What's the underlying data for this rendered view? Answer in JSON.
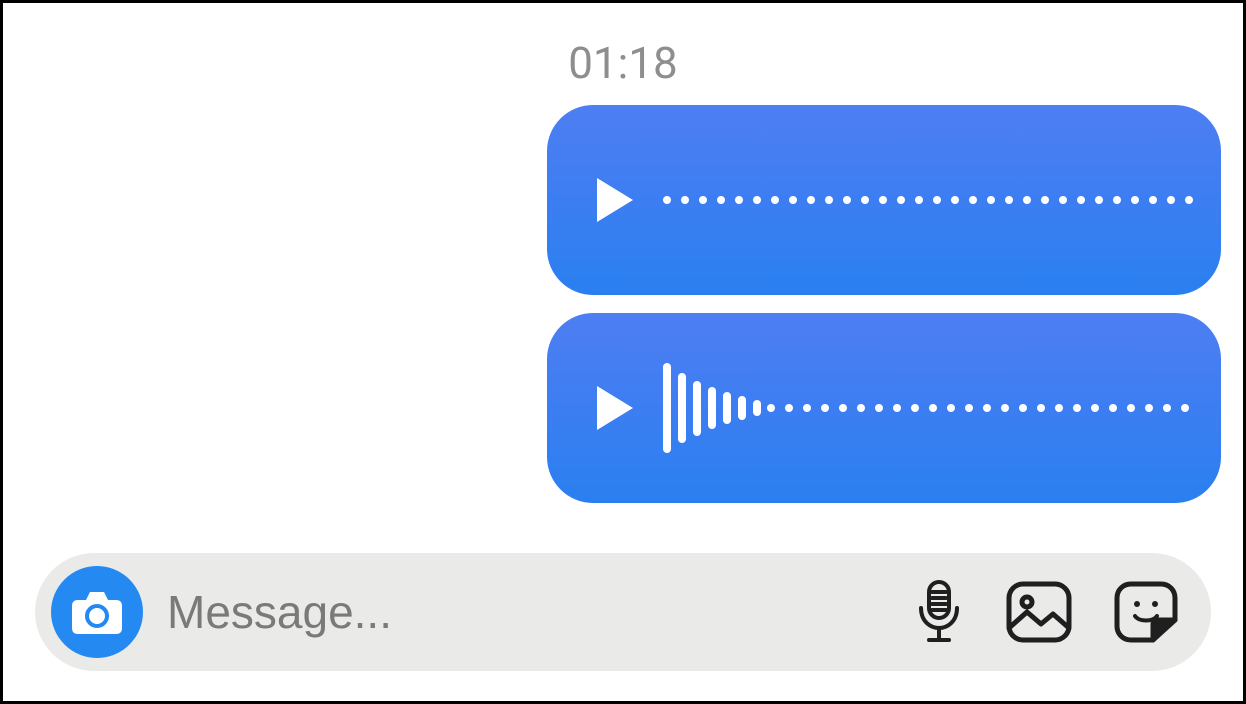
{
  "conversation": {
    "timestamp": "01:18",
    "messages": [
      {
        "type": "voice",
        "side": "outgoing",
        "waveform_style": "dots"
      },
      {
        "type": "voice",
        "side": "outgoing",
        "waveform_style": "bars_then_dots"
      }
    ]
  },
  "composer": {
    "placeholder": "Message...",
    "icons": {
      "camera": "camera-icon",
      "mic": "mic-icon",
      "gallery": "gallery-icon",
      "sticker": "sticker-icon"
    }
  },
  "colors": {
    "bubble_gradient_top": "#4e7ef3",
    "bubble_gradient_bottom": "#2a7ff0",
    "input_background": "#eaeae9",
    "timestamp_text": "#8e8e8e"
  },
  "waveforms": {
    "msg1_dot_count": 30,
    "msg2_bar_heights": [
      90,
      70,
      55,
      42,
      32,
      24,
      16
    ],
    "msg2_dot_count": 24
  }
}
